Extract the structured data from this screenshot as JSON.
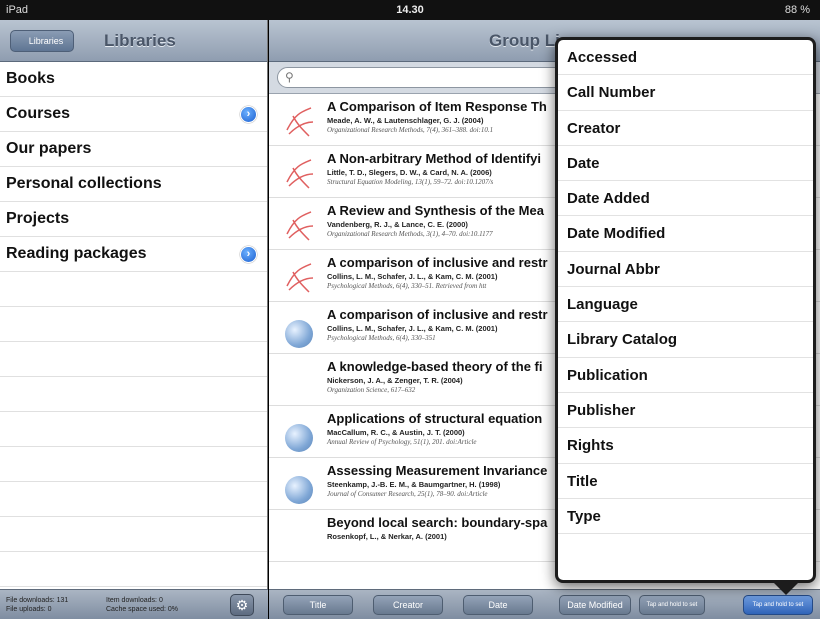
{
  "status_bar": {
    "device": "iPad",
    "time": "14.30",
    "battery": "88 %"
  },
  "left_pane": {
    "back_button": "Libraries",
    "title": "Libraries",
    "items": [
      {
        "label": "Books",
        "disclosure": false
      },
      {
        "label": "Courses",
        "disclosure": true
      },
      {
        "label": "Our papers",
        "disclosure": false
      },
      {
        "label": "Personal collections",
        "disclosure": false
      },
      {
        "label": "Projects",
        "disclosure": false
      },
      {
        "label": "Reading packages",
        "disclosure": true
      }
    ],
    "footer": {
      "file_downloads_label": "File downloads:",
      "file_downloads": "131",
      "item_downloads_label": "Item downloads:",
      "item_downloads": "0",
      "file_uploads_label": "File uploads:",
      "file_uploads": "0",
      "cache_label": "Cache space used:",
      "cache": "0%"
    }
  },
  "right_pane": {
    "title": "Group Li",
    "search": {
      "placeholder": ""
    },
    "items": [
      {
        "title": "A Comparison of Item Response Th",
        "authors": "Meade, A. W., & Lautenschlager, G. J. (2004)",
        "citation": "Organizational Research Methods, 7(4), 361–388. doi:10.1",
        "icon": "pdf"
      },
      {
        "title": "A Non-arbitrary Method of Identifyi",
        "authors": "Little, T. D., Slegers, D. W., & Card, N. A. (2006)",
        "citation": "Structural Equation Modeling, 13(1), 59–72. doi:10.1207/s",
        "icon": "pdf"
      },
      {
        "title": "A Review and Synthesis of the Mea",
        "authors": "Vandenberg, R. J., & Lance, C. E. (2000)",
        "citation": "Organizational Research Methods, 3(1), 4–70. doi:10.1177",
        "icon": "pdf"
      },
      {
        "title": "A comparison of inclusive and restr",
        "authors": "Collins, L. M., Schafer, J. L., & Kam, C. M. (2001)",
        "citation": "Psychological Methods, 6(4), 330–51. Retrieved from htt",
        "icon": "pdf"
      },
      {
        "title": "A comparison of inclusive and restr",
        "authors": "Collins, L. M., Schafer, J. L., & Kam, C. M. (2001)",
        "citation": "Psychological Methods, 6(4), 330–351",
        "icon": "globe"
      },
      {
        "title": "A knowledge-based theory of the fi",
        "authors": "Nickerson, J. A., & Zenger, T. R. (2004)",
        "citation": "Organization Science, 617–632",
        "icon": "none"
      },
      {
        "title": "Applications of structural equation",
        "authors": "MacCallum, R. C., & Austin, J. T. (2000)",
        "citation": "Annual Review of Psychology, 51(1), 201. doi:Article",
        "icon": "globe"
      },
      {
        "title": "Assessing Measurement Invariance",
        "authors": "Steenkamp, J.-B. E. M., & Baumgartner, H. (1998)",
        "citation": "Journal of Consumer Research, 25(1), 78–90. doi:Article",
        "icon": "globe"
      },
      {
        "title": "Beyond local search: boundary-spa",
        "authors": "Rosenkopf, L., & Nerkar, A. (2001)",
        "citation": "",
        "icon": "none"
      }
    ],
    "footer_buttons": [
      "Title",
      "Creator",
      "Date",
      "Date Modified",
      "Tap and hold to set",
      "Tap and hold to set"
    ]
  },
  "sort_popover": {
    "options": [
      "Accessed",
      "Call Number",
      "Creator",
      "Date",
      "Date Added",
      "Date Modified",
      "Journal Abbr",
      "Language",
      "Library Catalog",
      "Publication",
      "Publisher",
      "Rights",
      "Title",
      "Type"
    ]
  }
}
